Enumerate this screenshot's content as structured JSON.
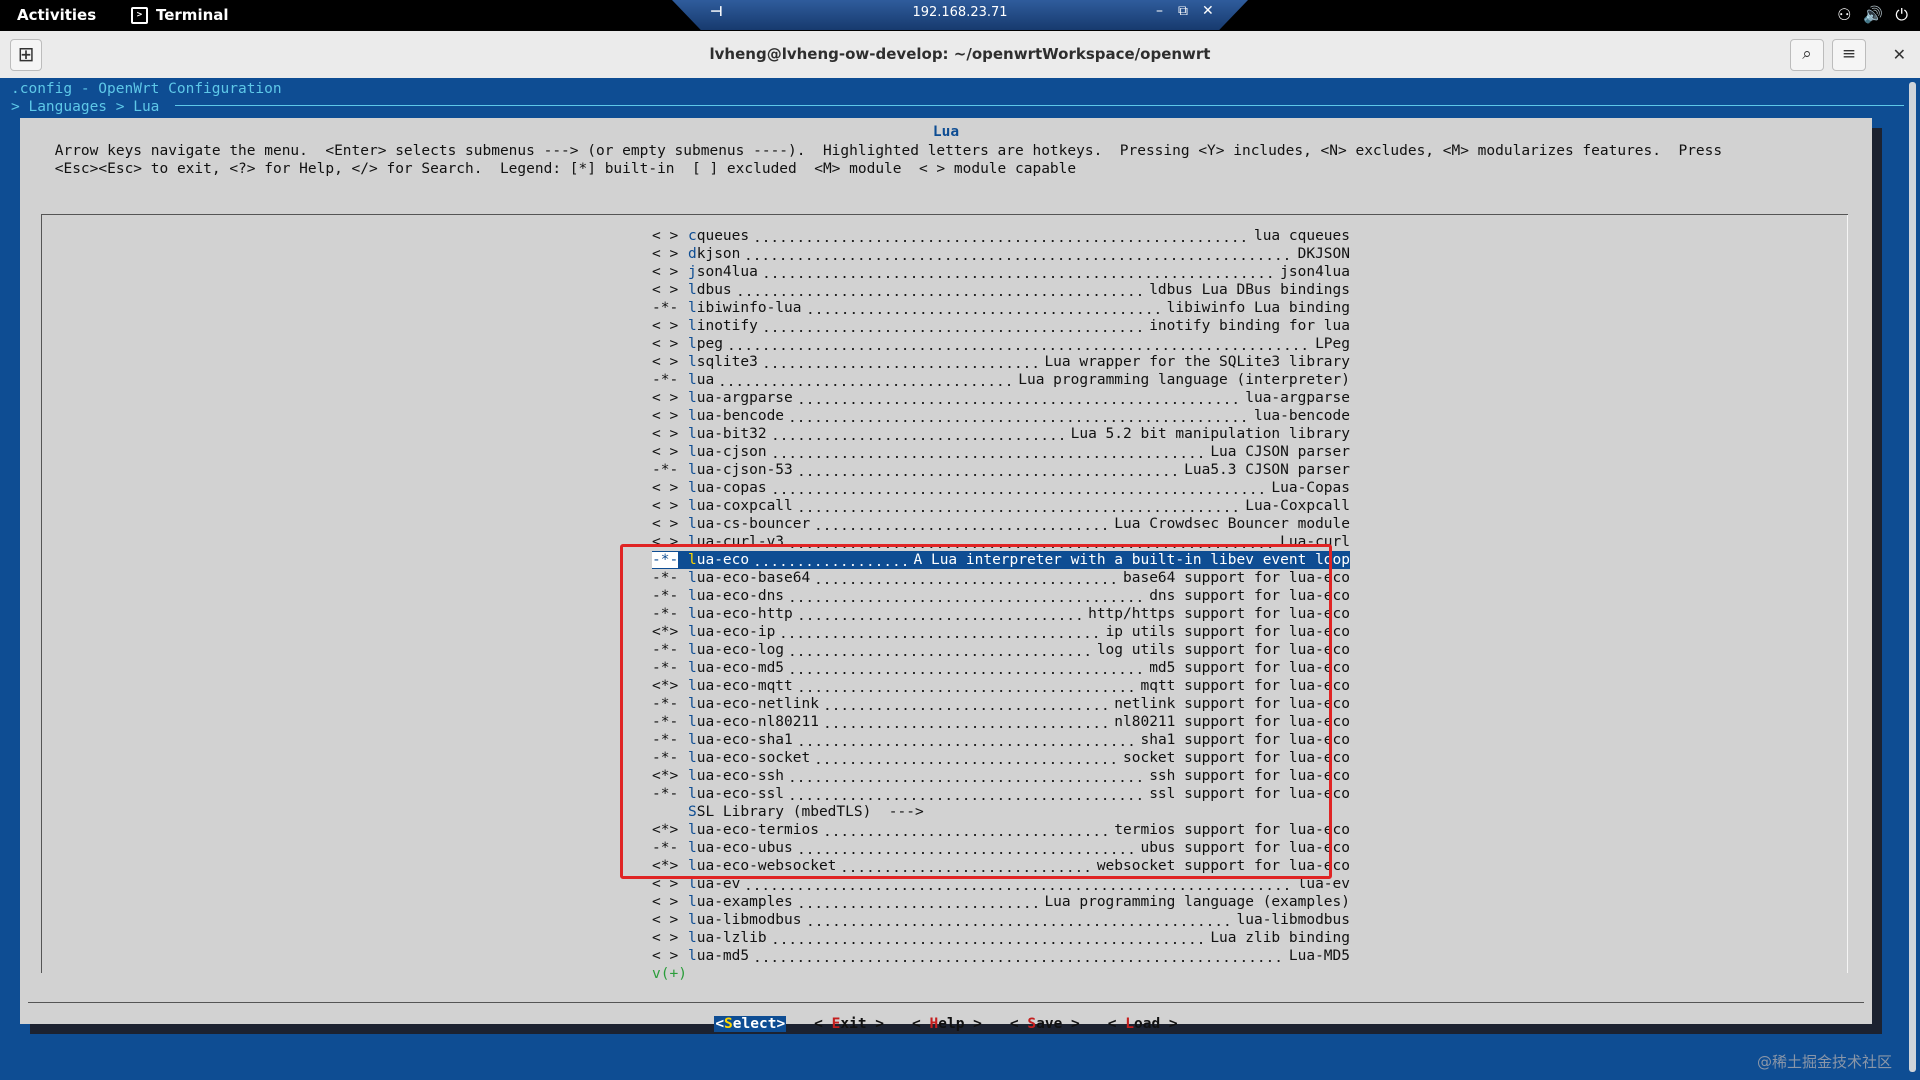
{
  "topbar": {
    "activities": "Activities",
    "app_name": "Terminal",
    "remote_host": "192.168.23.71",
    "pin": "⊣",
    "minimize": "–",
    "restore": "⧉",
    "close": "✕",
    "tray_icons": [
      "network-icon",
      "volume-icon",
      "power-icon"
    ],
    "tray_glyphs": [
      "⚇",
      "🔊",
      "⏻"
    ]
  },
  "window": {
    "title": "lvheng@lvheng-ow-develop: ~/openwrtWorkspace/openwrt",
    "new_tab": "⊞",
    "search": "⌕",
    "menu": "≡",
    "close": "✕"
  },
  "menuconfig": {
    "config_line": ".config - OpenWrt Configuration",
    "breadcrumb": "> Languages > Lua",
    "dialog_title": "Lua",
    "help_text": " Arrow keys navigate the menu.  <Enter> selects submenus ---> (or empty submenus ----).  Highlighted letters are hotkeys.  Pressing <Y> includes, <N> excludes, <M> modularizes features.  Press\n <Esc><Esc> to exit, <?> for Help, </> for Search.  Legend: [*] built-in  [ ] excluded  <M> module  < > module capable",
    "items": [
      {
        "state": "< >",
        "hotkey": "c",
        "rest": "queues",
        "desc": "lua cqueues"
      },
      {
        "state": "< >",
        "hotkey": "d",
        "rest": "kjson",
        "desc": "DKJSON"
      },
      {
        "state": "< >",
        "hotkey": "j",
        "rest": "son4lua",
        "desc": "json4lua"
      },
      {
        "state": "< >",
        "hotkey": "l",
        "rest": "dbus",
        "desc": "ldbus Lua DBus bindings"
      },
      {
        "state": "-*-",
        "hotkey": "l",
        "rest": "ibiwinfo-lua",
        "desc": "libiwinfo Lua binding"
      },
      {
        "state": "< >",
        "hotkey": "l",
        "rest": "inotify",
        "desc": "inotify binding for lua"
      },
      {
        "state": "< >",
        "hotkey": "l",
        "rest": "peg",
        "desc": "LPeg"
      },
      {
        "state": "< >",
        "hotkey": "l",
        "rest": "sqlite3",
        "desc": "Lua wrapper for the SQLite3 library"
      },
      {
        "state": "-*-",
        "hotkey": "l",
        "rest": "ua",
        "desc": "Lua programming language (interpreter)"
      },
      {
        "state": "< >",
        "hotkey": "l",
        "rest": "ua-argparse",
        "desc": "lua-argparse"
      },
      {
        "state": "< >",
        "hotkey": "l",
        "rest": "ua-bencode",
        "desc": "lua-bencode"
      },
      {
        "state": "< >",
        "hotkey": "l",
        "rest": "ua-bit32",
        "desc": "Lua 5.2 bit manipulation library"
      },
      {
        "state": "< >",
        "hotkey": "l",
        "rest": "ua-cjson",
        "desc": "Lua CJSON parser"
      },
      {
        "state": "-*-",
        "hotkey": "l",
        "rest": "ua-cjson-53",
        "desc": "Lua5.3 CJSON parser"
      },
      {
        "state": "< >",
        "hotkey": "l",
        "rest": "ua-copas",
        "desc": "Lua-Copas"
      },
      {
        "state": "< >",
        "hotkey": "l",
        "rest": "ua-coxpcall",
        "desc": "Lua-Coxpcall"
      },
      {
        "state": "< >",
        "hotkey": "l",
        "rest": "ua-cs-bouncer",
        "desc": "Lua Crowdsec Bouncer module"
      },
      {
        "state": "< >",
        "hotkey": "l",
        "rest": "ua-curl-v3",
        "desc": "Lua-curl"
      },
      {
        "state": "-*-",
        "hotkey": "l",
        "rest": "ua-eco",
        "desc": "A Lua interpreter with a built-in libev event loop",
        "selected": true
      },
      {
        "state": "-*-",
        "hotkey": "l",
        "rest": "ua-eco-base64",
        "desc": "base64 support for lua-eco"
      },
      {
        "state": "-*-",
        "hotkey": "l",
        "rest": "ua-eco-dns",
        "desc": "dns support for lua-eco"
      },
      {
        "state": "-*-",
        "hotkey": "l",
        "rest": "ua-eco-http",
        "desc": "http/https support for lua-eco"
      },
      {
        "state": "<*>",
        "hotkey": "l",
        "rest": "ua-eco-ip",
        "desc": "ip utils support for lua-eco"
      },
      {
        "state": "-*-",
        "hotkey": "l",
        "rest": "ua-eco-log",
        "desc": "log utils support for lua-eco"
      },
      {
        "state": "-*-",
        "hotkey": "l",
        "rest": "ua-eco-md5",
        "desc": "md5 support for lua-eco"
      },
      {
        "state": "<*>",
        "hotkey": "l",
        "rest": "ua-eco-mqtt",
        "desc": "mqtt support for lua-eco"
      },
      {
        "state": "-*-",
        "hotkey": "l",
        "rest": "ua-eco-netlink",
        "desc": "netlink support for lua-eco"
      },
      {
        "state": "-*-",
        "hotkey": "l",
        "rest": "ua-eco-nl80211",
        "desc": "nl80211 support for lua-eco"
      },
      {
        "state": "-*-",
        "hotkey": "l",
        "rest": "ua-eco-sha1",
        "desc": "sha1 support for lua-eco"
      },
      {
        "state": "-*-",
        "hotkey": "l",
        "rest": "ua-eco-socket",
        "desc": "socket support for lua-eco"
      },
      {
        "state": "<*>",
        "hotkey": "l",
        "rest": "ua-eco-ssh",
        "desc": "ssh support for lua-eco"
      },
      {
        "state": "-*-",
        "hotkey": "l",
        "rest": "ua-eco-ssl",
        "desc": "ssl support for lua-eco"
      },
      {
        "state": "   ",
        "hotkey": "S",
        "rest": "SL Library (mbedTLS)  --->",
        "desc": "",
        "plain": true
      },
      {
        "state": "<*>",
        "hotkey": "l",
        "rest": "ua-eco-termios",
        "desc": "termios support for lua-eco"
      },
      {
        "state": "-*-",
        "hotkey": "l",
        "rest": "ua-eco-ubus",
        "desc": "ubus support for lua-eco"
      },
      {
        "state": "<*>",
        "hotkey": "l",
        "rest": "ua-eco-websocket",
        "desc": "websocket support for lua-eco"
      },
      {
        "state": "< >",
        "hotkey": "l",
        "rest": "ua-ev",
        "desc": "lua-ev"
      },
      {
        "state": "< >",
        "hotkey": "l",
        "rest": "ua-examples",
        "desc": "Lua programming language (examples)"
      },
      {
        "state": "< >",
        "hotkey": "l",
        "rest": "ua-libmodbus",
        "desc": "lua-libmodbus"
      },
      {
        "state": "< >",
        "hotkey": "l",
        "rest": "ua-lzlib",
        "desc": "Lua zlib binding"
      },
      {
        "state": "< >",
        "hotkey": "l",
        "rest": "ua-md5",
        "desc": "Lua-MD5"
      }
    ],
    "more_indicator": "v(+)",
    "buttons": [
      {
        "pre": "<",
        "hotkey": "S",
        "rest": "elect",
        "post": ">",
        "active": true
      },
      {
        "pre": "< ",
        "hotkey": "E",
        "rest": "xit",
        "post": " >"
      },
      {
        "pre": "< ",
        "hotkey": "H",
        "rest": "elp",
        "post": " >"
      },
      {
        "pre": "< ",
        "hotkey": "S",
        "rest": "ave",
        "post": " >"
      },
      {
        "pre": "< ",
        "hotkey": "L",
        "rest": "oad",
        "post": " >"
      }
    ]
  },
  "watermark": "@稀土掘金技术社区",
  "colors": {
    "terminal_blue": "#0e4d93",
    "dialog_gray": "#d2d2d2",
    "highlight_red": "#e02424",
    "more_green": "#2a9d3a"
  }
}
